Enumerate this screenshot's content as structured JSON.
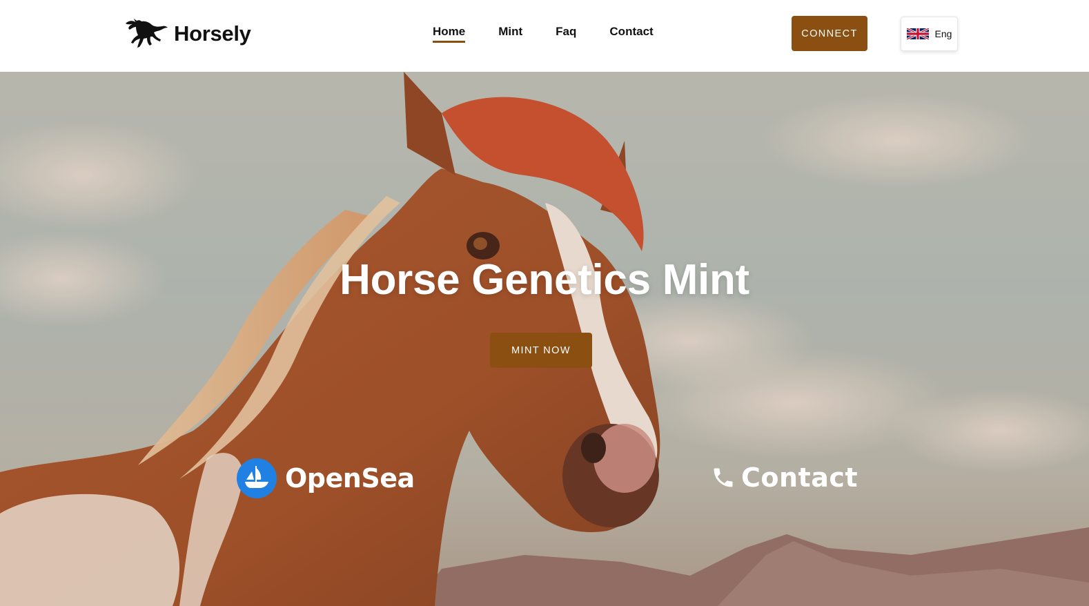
{
  "brand": {
    "name": "Horsely",
    "logo_icon": "running-horse-icon"
  },
  "nav": {
    "items": [
      {
        "label": "Home",
        "active": true
      },
      {
        "label": "Mint",
        "active": false
      },
      {
        "label": "Faq",
        "active": false
      },
      {
        "label": "Contact",
        "active": false
      }
    ]
  },
  "header": {
    "connect_label": "CONNECT",
    "language": {
      "label": "Eng",
      "flag_icon": "uk-flag-icon"
    }
  },
  "hero": {
    "title": "Horse Genetics Mint",
    "mint_label": "MINT NOW",
    "opensea": {
      "label": "OpenSea",
      "icon": "opensea-icon"
    },
    "contact": {
      "label": "Contact",
      "icon": "phone-icon"
    }
  },
  "colors": {
    "accent": "#8b4f12",
    "text_dark": "#111111",
    "opensea_blue": "#2081e2",
    "white": "#ffffff"
  }
}
